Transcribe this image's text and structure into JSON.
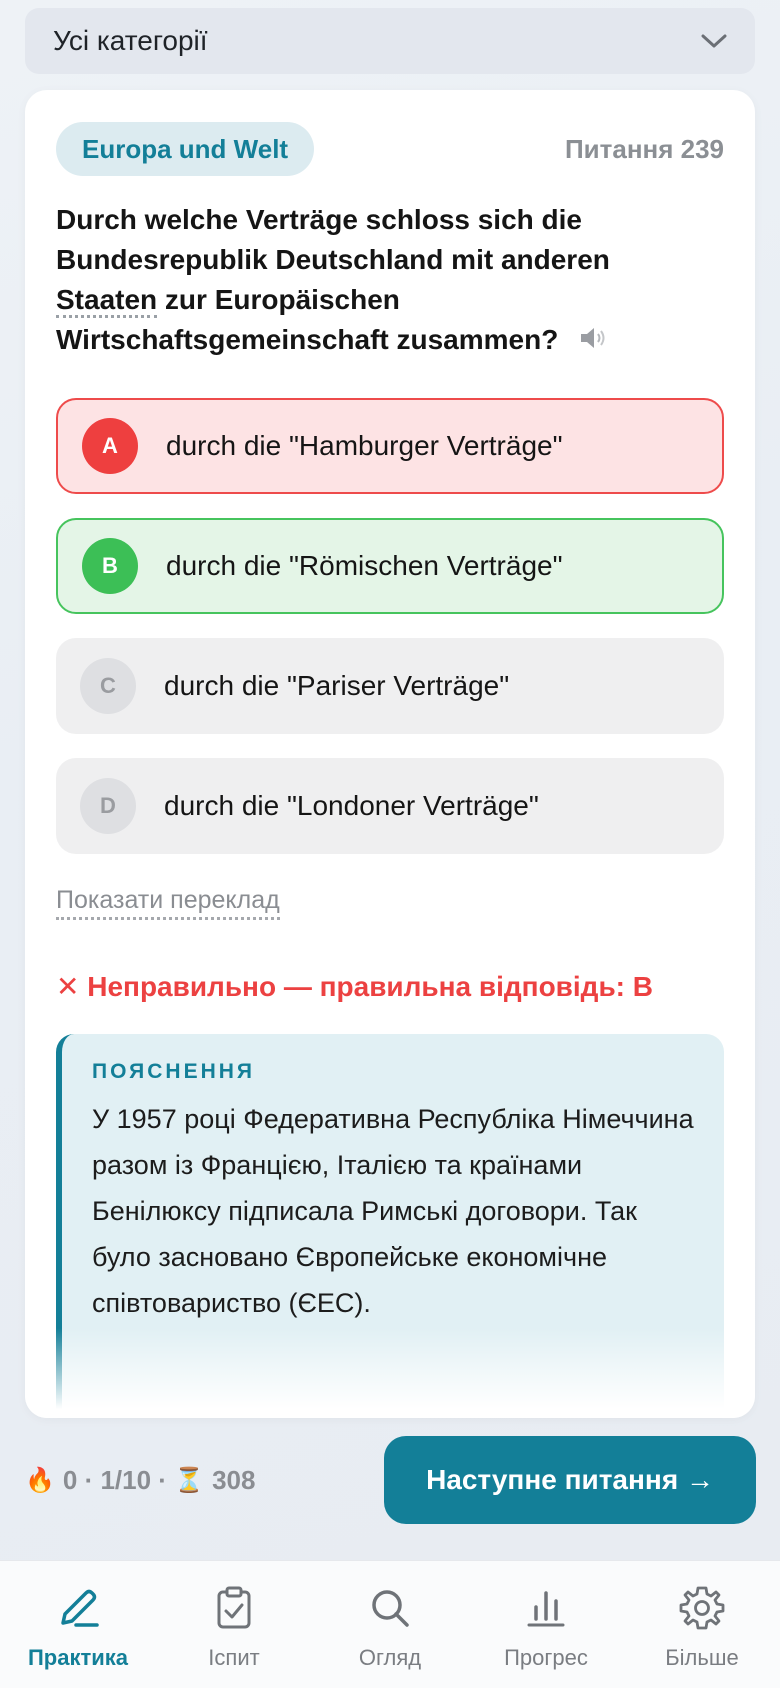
{
  "category_select": {
    "value": "Усі категорії",
    "icon": "chevron-down-icon"
  },
  "question": {
    "category": "Europa und Welt",
    "number_label": "Питання 239",
    "text_part1": "Durch welche Verträge schloss sich die Bundesrepublik Deutschland mit anderen ",
    "text_underlined": "Staaten",
    "text_part2": " zur Europäischen Wirtschaftsgemeinschaft zusammen?",
    "speaker_icon": "speaker-icon"
  },
  "options": [
    {
      "letter": "A",
      "text": "durch die \"Hamburger Verträge\"",
      "state": "wrong"
    },
    {
      "letter": "B",
      "text": "durch die \"Römischen Verträge\"",
      "state": "correct"
    },
    {
      "letter": "C",
      "text": "durch die \"Pariser Verträge\"",
      "state": "neutral"
    },
    {
      "letter": "D",
      "text": "durch die \"Londoner Verträge\"",
      "state": "neutral"
    }
  ],
  "show_translation": "Показати переклад",
  "verdict": "✕ Неправильно — правильна відповідь: B",
  "explanation": {
    "title": "ПОЯСНЕННЯ",
    "body": "У 1957 році Федеративна Республіка Німеччина разом із Францією, Італією та країнами Бенілюксу підписала Римські договори. Так було засновано Європейське економічне співтовариство (ЄЕС)."
  },
  "stats": {
    "streak_icon": "🔥",
    "streak": "0",
    "progress": "1/10",
    "timer_icon": "⏳",
    "timer": "308"
  },
  "next_button": "Наступне питання →",
  "tabs": [
    {
      "label": "Практика",
      "icon": "pencil-icon",
      "active": true
    },
    {
      "label": "Іспит",
      "icon": "clipboard-check-icon",
      "active": false
    },
    {
      "label": "Огляд",
      "icon": "search-icon",
      "active": false
    },
    {
      "label": "Прогрес",
      "icon": "bar-chart-icon",
      "active": false
    },
    {
      "label": "Більше",
      "icon": "gear-icon",
      "active": false
    }
  ],
  "colors": {
    "accent": "#137f98",
    "wrong": "#ee3f3f",
    "correct": "#3cbf56"
  }
}
